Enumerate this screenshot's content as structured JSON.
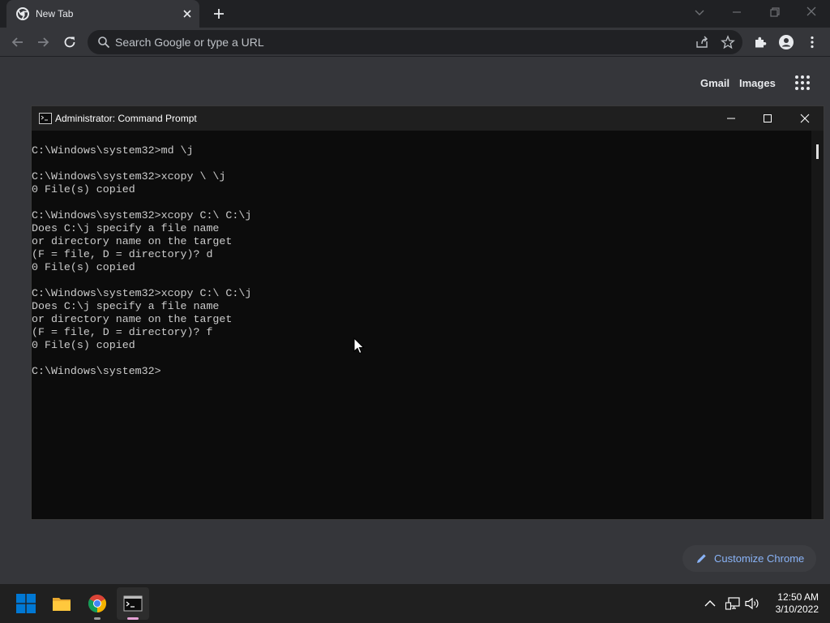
{
  "browser": {
    "tab_title": "New Tab",
    "omnibox_placeholder": "Search Google or type a URL"
  },
  "ntp": {
    "links": {
      "gmail": "Gmail",
      "images": "Images"
    },
    "customize_label": "Customize Chrome"
  },
  "cmd_window": {
    "title": "Administrator: Command Prompt",
    "lines": [
      "C:\\Windows\\system32>md \\j",
      "",
      "C:\\Windows\\system32>xcopy \\ \\j",
      "0 File(s) copied",
      "",
      "C:\\Windows\\system32>xcopy C:\\ C:\\j",
      "Does C:\\j specify a file name",
      "or directory name on the target",
      "(F = file, D = directory)? d",
      "0 File(s) copied",
      "",
      "C:\\Windows\\system32>xcopy C:\\ C:\\j",
      "Does C:\\j specify a file name",
      "or directory name on the target",
      "(F = file, D = directory)? f",
      "0 File(s) copied",
      "",
      "C:\\Windows\\system32>"
    ]
  },
  "taskbar": {
    "apps": [
      "start-icon",
      "file-explorer-icon",
      "chrome-icon",
      "command-prompt-icon"
    ],
    "active_app": "command-prompt-icon",
    "clock": {
      "time": "12:50 AM",
      "date": "3/10/2022"
    }
  },
  "colors": {
    "chrome_dark": "#35363a",
    "tabstrip": "#202124",
    "console_bg": "#0c0c0c",
    "console_text": "#cccccc",
    "customize_text": "#8ab4f8",
    "windows_blue": "#0078d4"
  }
}
